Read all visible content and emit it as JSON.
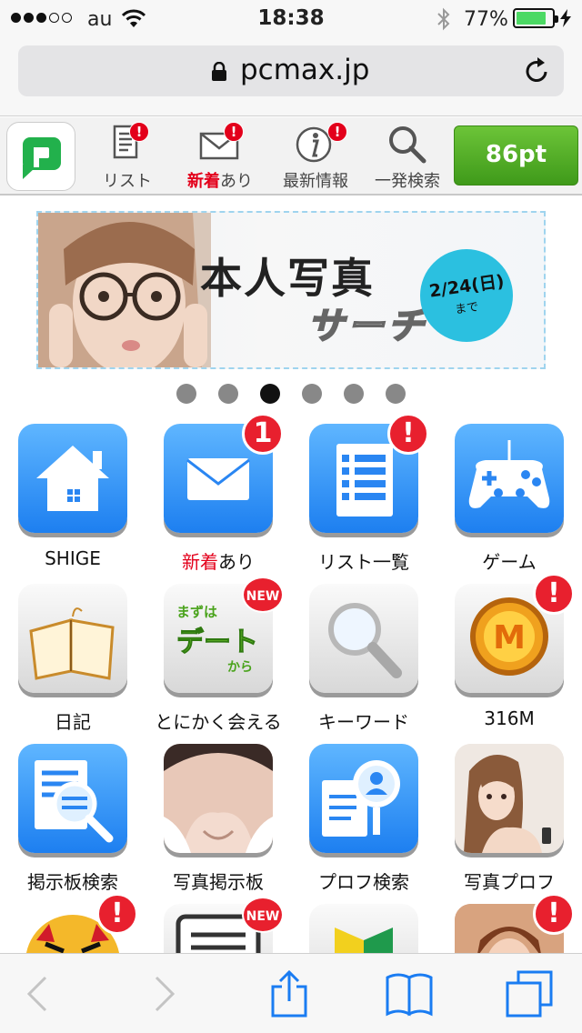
{
  "status": {
    "carrier": "au",
    "time": "18:38",
    "battery_pct": "77%",
    "battery_level": 0.77,
    "signal_bars": 3,
    "signal_max": 5
  },
  "browser": {
    "url": "pcmax.jp",
    "lock_icon": "lock-icon",
    "reload_icon": "reload-icon"
  },
  "header": {
    "logo_icon": "pcmax-logo-icon",
    "nav": [
      {
        "label": "リスト",
        "icon": "list-doc-icon",
        "badge": "!"
      },
      {
        "label_red": "新着",
        "label_rest": "あり",
        "icon": "envelope-icon",
        "badge": "!"
      },
      {
        "label": "最新情報",
        "icon": "info-icon",
        "badge": "!"
      },
      {
        "label": "一発検索",
        "icon": "search-icon"
      }
    ],
    "points": "86pt"
  },
  "banner": {
    "title": "本人写真",
    "subtitle": "サーチ",
    "date": "2/24(日)",
    "until": "まで"
  },
  "carousel": {
    "count": 6,
    "active_index": 2
  },
  "grid": [
    {
      "label": "SHIGE",
      "icon": "home-icon"
    },
    {
      "label_red": "新着",
      "label_rest": "あり",
      "icon": "mail-icon",
      "badge": "1"
    },
    {
      "label": "リスト一覧",
      "icon": "list-icon",
      "badge": "!"
    },
    {
      "label": "ゲーム",
      "icon": "gamepad-icon"
    },
    {
      "label": "日記",
      "icon": "diary-book-icon"
    },
    {
      "label": "とにかく会える",
      "icon": "date-first-icon",
      "badge": "NEW",
      "icon_text_top": "まずは",
      "icon_text_mid": "デート",
      "icon_text_bot": "から"
    },
    {
      "label": "キーワード",
      "icon": "magnifier-icon"
    },
    {
      "label": "316M",
      "icon": "m-coin-icon",
      "badge": "!",
      "icon_text": "M"
    },
    {
      "label": "掲示板検索",
      "icon": "board-search-icon"
    },
    {
      "label": "写真掲示板",
      "icon": "photo-board-thumbnail"
    },
    {
      "label": "プロフ検索",
      "icon": "profile-search-icon"
    },
    {
      "label": "写真プロフ",
      "icon": "photo-profile-thumbnail"
    }
  ],
  "partial_row": [
    {
      "icon": "tiger-icon",
      "badge": "!"
    },
    {
      "icon": "message-icon",
      "badge": "NEW"
    },
    {
      "icon": "beginner-mark-icon"
    },
    {
      "icon": "photo-thumbnail",
      "badge": "!"
    }
  ],
  "toolbar": {
    "back_icon": "back-icon",
    "forward_icon": "forward-icon",
    "share_icon": "share-icon",
    "bookmarks_icon": "bookmarks-icon",
    "tabs_icon": "tabs-icon"
  }
}
